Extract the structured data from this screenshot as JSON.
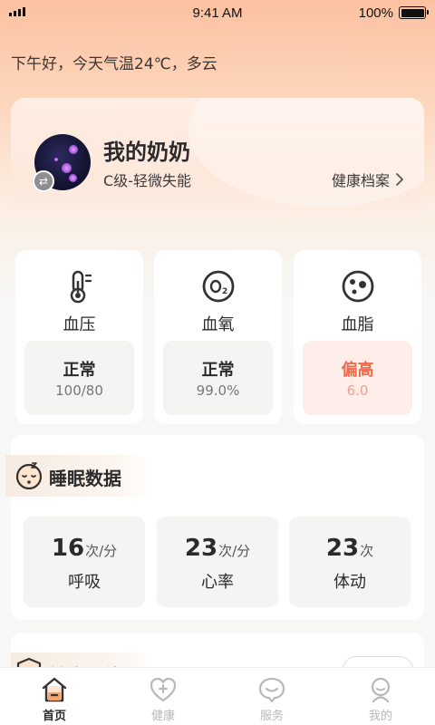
{
  "status_bar": {
    "time": "9:41 AM",
    "battery": "100%"
  },
  "greeting": "下午好，今天气温24℃，多云",
  "profile": {
    "name": "我的奶奶",
    "level": "C级-轻微失能",
    "health_file_label": "健康档案"
  },
  "metrics": [
    {
      "label": "血压",
      "status": "正常",
      "value": "100/80",
      "icon": "thermometer-icon",
      "alert": false
    },
    {
      "label": "血氧",
      "status": "正常",
      "value": "99.0%",
      "icon": "oxygen-icon",
      "alert": false
    },
    {
      "label": "血脂",
      "status": "偏高",
      "value": "6.0",
      "icon": "cholesterol-icon",
      "alert": true
    }
  ],
  "sleep": {
    "title": "睡眠数据",
    "items": [
      {
        "value": "16",
        "unit": "次/分",
        "label": "呼吸"
      },
      {
        "value": "23",
        "unit": "次/分",
        "label": "心率"
      },
      {
        "value": "23",
        "unit": "次",
        "label": "体动"
      }
    ]
  },
  "next_section": {
    "title": "健康评估"
  },
  "tabs": [
    {
      "label": "首页",
      "icon": "home-icon",
      "active": true
    },
    {
      "label": "健康",
      "icon": "health-heart-icon",
      "active": false
    },
    {
      "label": "服务",
      "icon": "service-chat-icon",
      "active": false
    },
    {
      "label": "我的",
      "icon": "profile-icon",
      "active": false
    }
  ],
  "colors": {
    "accent": "#ee6b4d",
    "accent_light": "#f1a18a",
    "header_bg": "#fcc1a1"
  }
}
